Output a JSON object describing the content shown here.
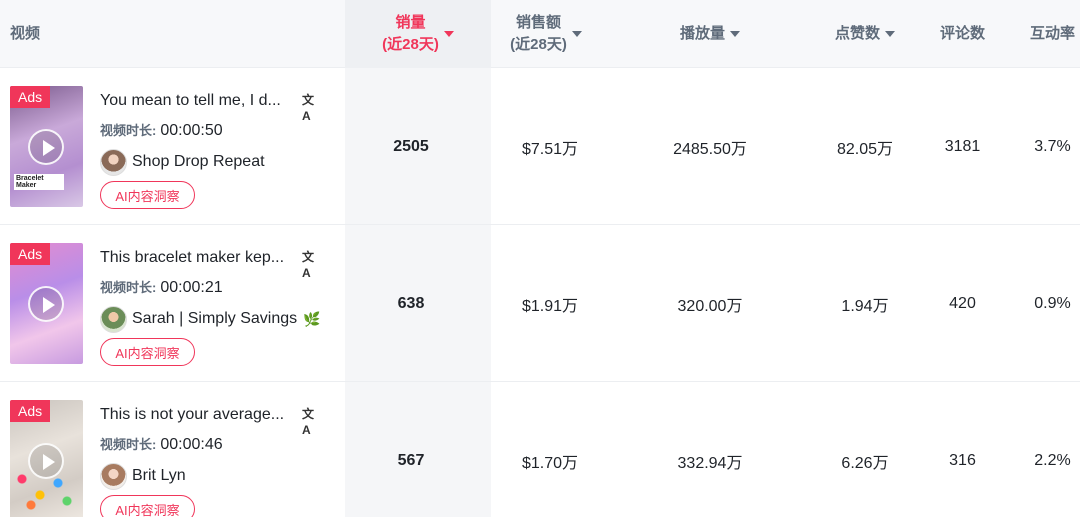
{
  "header": {
    "video": "视频",
    "sales_line1": "销量",
    "sales_line2": "(近28天)",
    "revenue_line1": "销售额",
    "revenue_line2": "(近28天)",
    "views": "播放量",
    "likes": "点赞数",
    "comments": "评论数",
    "engagement": "互动率"
  },
  "labels": {
    "ads": "Ads",
    "duration": "视频时长:",
    "ai_button": "AI内容洞察",
    "translate_icon": "translate-icon",
    "play_icon": "play-icon"
  },
  "colors": {
    "accent": "#f0365a",
    "header_text": "#5f6b7a"
  },
  "rows": [
    {
      "title": "You mean to tell me, I d...",
      "duration": "00:00:50",
      "creator": "Shop Drop Repeat",
      "thumb_caption": "Bracelet Maker",
      "sales": "2505",
      "revenue": "$7.51万",
      "views": "2485.50万",
      "likes": "82.05万",
      "comments": "3181",
      "engagement": "3.7%"
    },
    {
      "title": "This bracelet maker kep...",
      "duration": "00:00:21",
      "creator": "Sarah | Simply Savings",
      "creator_badge": "🌿",
      "sales": "638",
      "revenue": "$1.91万",
      "views": "320.00万",
      "likes": "1.94万",
      "comments": "420",
      "engagement": "0.9%"
    },
    {
      "title": "This is not your average...",
      "duration": "00:00:46",
      "creator": "Brit Lyn",
      "sales": "567",
      "revenue": "$1.70万",
      "views": "332.94万",
      "likes": "6.26万",
      "comments": "316",
      "engagement": "2.2%"
    }
  ]
}
